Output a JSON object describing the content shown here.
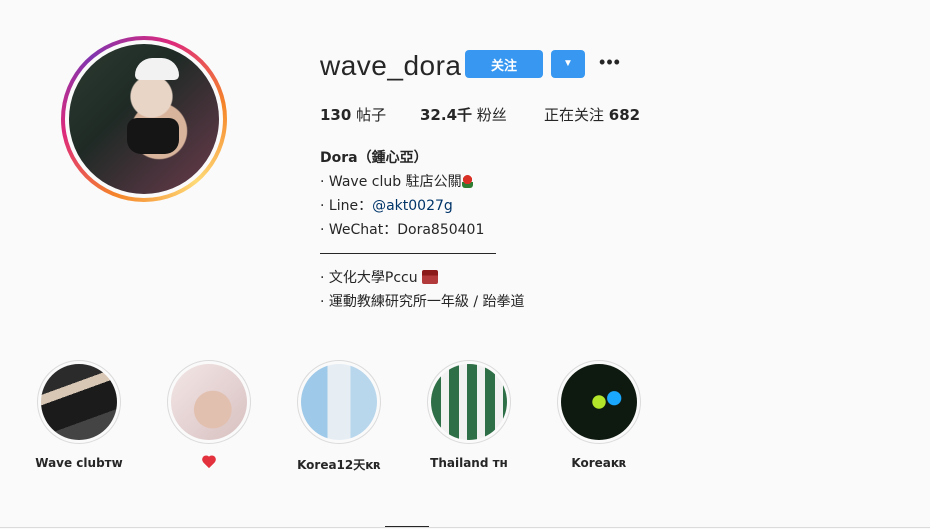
{
  "profile": {
    "username": "wave_dora",
    "follow_label": "关注",
    "dropdown_icon": "caret-down",
    "more_icon": "ellipsis",
    "more_glyph": "•••"
  },
  "stats": {
    "posts_value": "130",
    "posts_label": "帖子",
    "followers_value": "32.4千",
    "followers_label": "粉丝",
    "following_label": "正在关注",
    "following_value": "682"
  },
  "bio": {
    "name": "Dora（鍾心亞）",
    "line1": "· Wave club 駐店公關",
    "line2_prefix": "· Line：",
    "line2_link": "@akt0027g",
    "line3": "· WeChat：Dora850401",
    "line4": "· 文化大學Pccu",
    "line5": "· 運動教練研究所一年級 / 跆拳道"
  },
  "highlights": [
    {
      "label": "Wave clubᴛᴡ"
    },
    {
      "label": "",
      "icon": "heart-icon"
    },
    {
      "label": "Korea12天ᴋʀ"
    },
    {
      "label": "Thailand ᴛʜ"
    },
    {
      "label": "Koreaᴋʀ"
    }
  ],
  "colors": {
    "accent": "#3897f0",
    "text": "#262626",
    "link": "#003569",
    "background": "#fafafa"
  }
}
